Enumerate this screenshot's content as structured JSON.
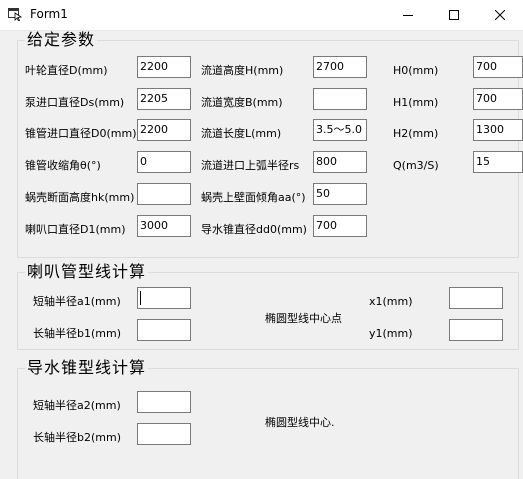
{
  "window": {
    "title": "Form1",
    "icon": "form-icon",
    "controls": [
      "minimize-icon",
      "maximize-icon",
      "close-icon"
    ]
  },
  "groups": {
    "params": {
      "title": "给定参数",
      "fields": {
        "impeller_d": {
          "label": "叶轮直径D(mm)",
          "value": "2200"
        },
        "pump_inlet_ds": {
          "label": "泵进口直径Ds(mm)",
          "value": "2205"
        },
        "cone_inlet_d0": {
          "label": "锥管进口直径D0(mm)",
          "value": "2200"
        },
        "cone_angle": {
          "label": "锥管收缩角θ(°)",
          "value": "0"
        },
        "volute_hk": {
          "label": "蜗壳断面高度hk(mm)",
          "value": ""
        },
        "bell_d1": {
          "label": "喇叭口直径D1(mm)",
          "value": "3000"
        },
        "channel_h": {
          "label": "流道高度H(mm)",
          "value": "2700"
        },
        "channel_b": {
          "label": "流道宽度B(mm)",
          "value": ""
        },
        "channel_l": {
          "label": "流道长度L(mm)",
          "value": "3.5～5.0"
        },
        "channel_rs": {
          "label": "流道进口上弧半径rs",
          "value": "800"
        },
        "volute_aa": {
          "label": "蜗壳上壁面倾角aa(°)",
          "value": "50"
        },
        "guide_dd0": {
          "label": "导水锥直径dd0(mm)",
          "value": "700"
        },
        "h0": {
          "label": "H0(mm)",
          "value": "700"
        },
        "h1": {
          "label": "H1(mm)",
          "value": "700"
        },
        "h2": {
          "label": "H2(mm)",
          "value": "1300"
        },
        "q": {
          "label": "Q(m3/S)",
          "value": "15"
        }
      }
    },
    "bell": {
      "title": "喇叭管型线计算",
      "a1_label": "短轴半径a1(mm)",
      "a1_value": "",
      "b1_label": "长轴半径b1(mm)",
      "b1_value": "",
      "center_label": "椭圆型线中心点",
      "x1_label": "x1(mm)",
      "x1_value": "",
      "y1_label": "y1(mm)",
      "y1_value": ""
    },
    "cone": {
      "title": "导水锥型线计算",
      "a2_label": "短轴半径a2(mm)",
      "a2_value": "",
      "b2_label": "长轴半径b2(mm)",
      "b2_value": "",
      "center_label": "椭圆型线中心."
    }
  }
}
